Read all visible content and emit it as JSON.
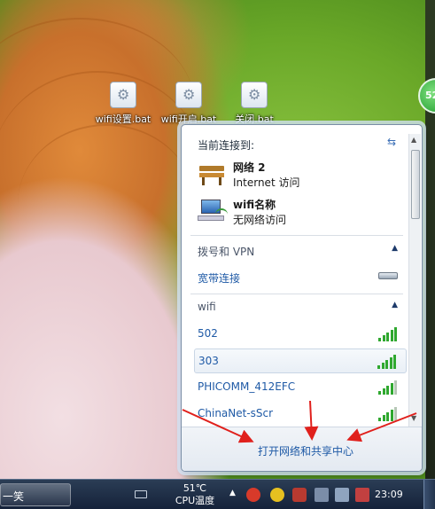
{
  "desktop": {
    "icons": [
      {
        "label": "wifi设置.bat",
        "icon": "bat-gear-icon"
      },
      {
        "label": "wifi开启.bat",
        "icon": "bat-gear-icon"
      },
      {
        "label": "关闭.bat",
        "icon": "bat-gear-icon"
      }
    ],
    "gadget_value": "52"
  },
  "flyout": {
    "header": "当前连接到:",
    "connections": [
      {
        "name": "网络  2",
        "status": "Internet 访问",
        "icon": "bench-network-icon"
      },
      {
        "name": "wifi名称",
        "status": "无网络访问",
        "icon": "computer-network-icon"
      }
    ],
    "dialup_section": {
      "title": "拨号和 VPN",
      "items": [
        {
          "name": "宽带连接",
          "icon": "modem-icon"
        }
      ]
    },
    "wifi_section": {
      "title": "wifi",
      "networks": [
        {
          "name": "502",
          "signal_bars": 5,
          "selected": false
        },
        {
          "name": "303",
          "signal_bars": 5,
          "selected": true
        },
        {
          "name": "PHICOMM_412EFC",
          "signal_bars": 4,
          "selected": false
        },
        {
          "name": "ChinaNet-sScr",
          "signal_bars": 4,
          "selected": false
        }
      ]
    },
    "footer_link": "打开网络和共享中心"
  },
  "taskbar": {
    "task_label": "一笑",
    "cpu_temp": "51℃",
    "cpu_label": "CPU温度",
    "clock": "23:09"
  },
  "colors": {
    "link": "#1f5aa6",
    "signal": "#2fa82f",
    "annotation_arrow": "#e0201c"
  }
}
